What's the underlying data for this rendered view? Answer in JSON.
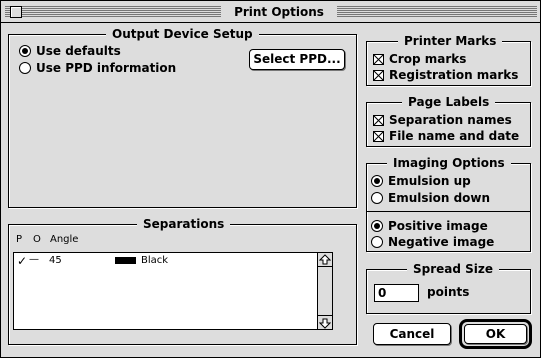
{
  "window": {
    "title": "Print Options"
  },
  "output_device": {
    "legend": "Output Device Setup",
    "options": [
      {
        "label": "Use defaults",
        "selected": true
      },
      {
        "label": "Use PPD information",
        "selected": false
      }
    ],
    "select_ppd_label": "Select PPD..."
  },
  "separations": {
    "legend": "Separations",
    "columns": [
      "P",
      "O",
      "Angle"
    ],
    "rows": [
      {
        "print_mark": "✓",
        "override_mark": "—",
        "angle": "45",
        "swatch_color": "#000000",
        "name": "Black"
      }
    ]
  },
  "printer_marks": {
    "legend": "Printer Marks",
    "items": [
      {
        "label": "Crop marks",
        "checked": true
      },
      {
        "label": "Registration marks",
        "checked": true
      }
    ]
  },
  "page_labels": {
    "legend": "Page Labels",
    "items": [
      {
        "label": "Separation names",
        "checked": true
      },
      {
        "label": "File name and date",
        "checked": true
      }
    ]
  },
  "imaging_options": {
    "legend": "Imaging Options",
    "emulsion": [
      {
        "label": "Emulsion up",
        "selected": true
      },
      {
        "label": "Emulsion down",
        "selected": false
      }
    ],
    "image": [
      {
        "label": "Positive image",
        "selected": true
      },
      {
        "label": "Negative image",
        "selected": false
      }
    ]
  },
  "spread_size": {
    "legend": "Spread Size",
    "value": "0",
    "unit": "points"
  },
  "buttons": {
    "cancel": "Cancel",
    "ok": "OK"
  },
  "icons": {
    "close": "close-box-icon",
    "check": "x-check-icon",
    "scroll_up": "scroll-up-arrow-icon",
    "scroll_down": "scroll-down-arrow-icon"
  }
}
